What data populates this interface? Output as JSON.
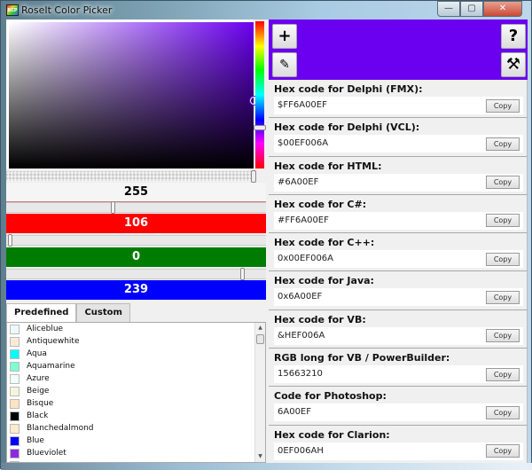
{
  "window": {
    "title": "RoseIt Color Picker",
    "controls": {
      "minimize": "—",
      "maximize": "▢",
      "close": "✕"
    }
  },
  "picker": {
    "current_color": "#6A00EF",
    "hue_gradient_stops": [
      "#FF0000",
      "#FFFF00",
      "#00FF00",
      "#00FFFF",
      "#0000FF",
      "#FF00FF",
      "#FF0000"
    ]
  },
  "channels": {
    "alpha": {
      "value": "255",
      "fraction": 1.0,
      "color": "#F5F5F5"
    },
    "red": {
      "value": "106",
      "fraction": 0.416,
      "color": "#FF0000"
    },
    "green": {
      "value": "0",
      "fraction": 0.0,
      "color": "#007D00"
    },
    "blue": {
      "value": "239",
      "fraction": 0.937,
      "color": "#0000FF"
    }
  },
  "tabs": [
    {
      "label": "Predefined",
      "active": true
    },
    {
      "label": "Custom",
      "active": false
    }
  ],
  "color_list": [
    {
      "name": "Aliceblue",
      "hex": "#F0F8FF"
    },
    {
      "name": "Antiquewhite",
      "hex": "#FAEBD7"
    },
    {
      "name": "Aqua",
      "hex": "#00FFFF"
    },
    {
      "name": "Aquamarine",
      "hex": "#7FFFD4"
    },
    {
      "name": "Azure",
      "hex": "#F0FFFF"
    },
    {
      "name": "Beige",
      "hex": "#F5F5DC"
    },
    {
      "name": "Bisque",
      "hex": "#FFE4C4"
    },
    {
      "name": "Black",
      "hex": "#000000"
    },
    {
      "name": "Blanchedalmond",
      "hex": "#FFEBCD"
    },
    {
      "name": "Blue",
      "hex": "#0000FF"
    },
    {
      "name": "Blueviolet",
      "hex": "#8A2BE2"
    },
    {
      "name": "",
      "hex": "#A52A2A"
    }
  ],
  "toolbar": {
    "add_icon": "+",
    "eyedropper_icon": "✎",
    "help_icon": "?",
    "settings_icon": "⚒"
  },
  "codes": [
    {
      "label": "Hex code for Delphi (FMX):",
      "value": "$FF6A00EF",
      "button": "Copy"
    },
    {
      "label": "Hex code for Delphi (VCL):",
      "value": "$00EF006A",
      "button": "Copy"
    },
    {
      "label": "Hex code for HTML:",
      "value": "#6A00EF",
      "button": "Copy"
    },
    {
      "label": "Hex code for C#:",
      "value": "#FF6A00EF",
      "button": "Copy"
    },
    {
      "label": "Hex code for C++:",
      "value": "0x00EF006A",
      "button": "Copy"
    },
    {
      "label": "Hex code for Java:",
      "value": "0x6A00EF",
      "button": "Copy"
    },
    {
      "label": "Hex code for VB:",
      "value": "&HEF006A",
      "button": "Copy"
    },
    {
      "label": "RGB long for VB / PowerBuilder:",
      "value": "15663210",
      "button": "Copy"
    },
    {
      "label": "Code for Photoshop:",
      "value": "6A00EF",
      "button": "Copy"
    },
    {
      "label": "Hex code for Clarion:",
      "value": "0EF006AH",
      "button": "Copy"
    }
  ]
}
